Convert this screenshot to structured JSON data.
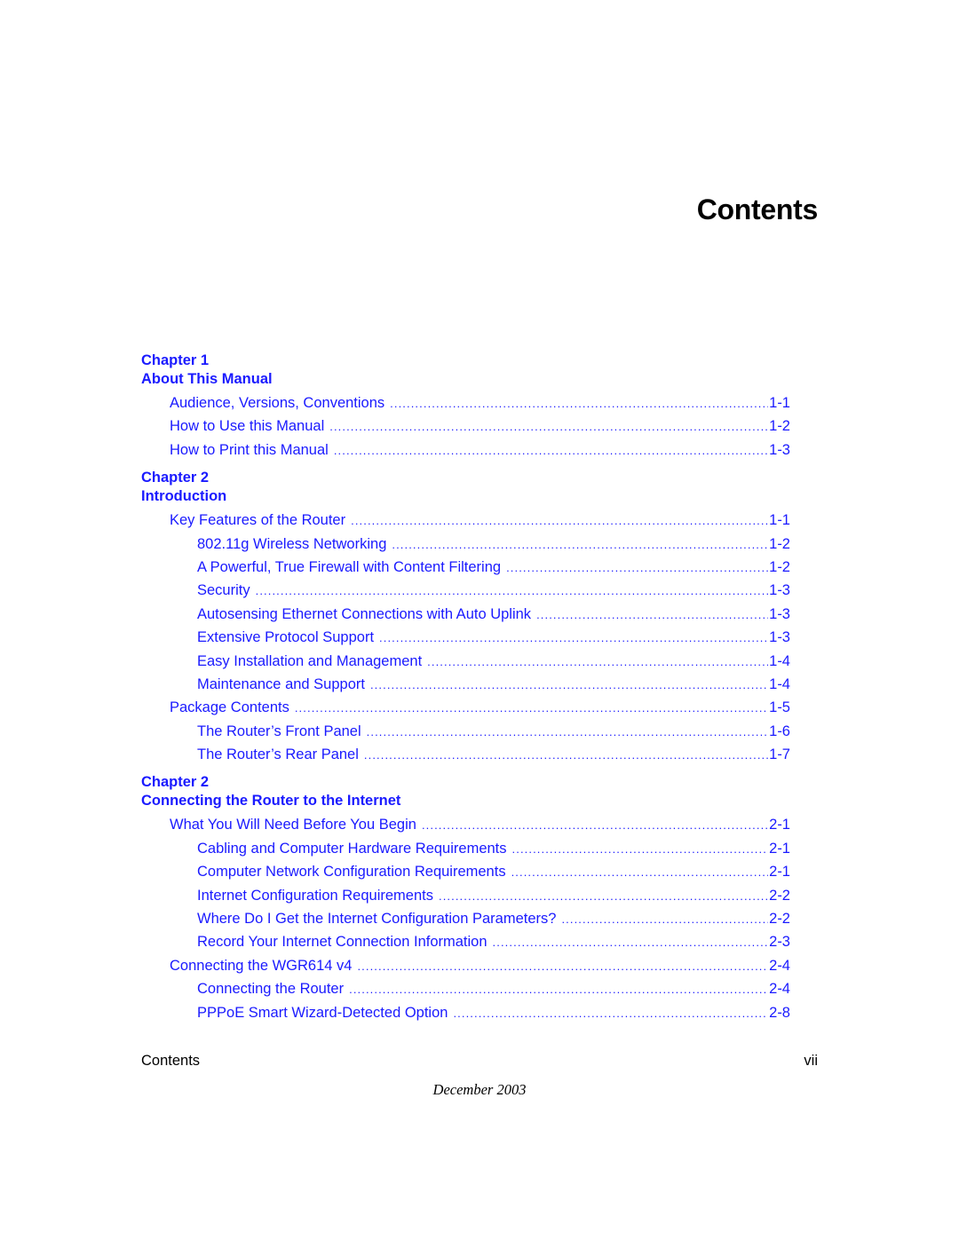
{
  "page": {
    "title": "Contents",
    "link_color": "#1a1aff"
  },
  "toc": [
    {
      "chapter": "Chapter 1",
      "title": "About This Manual",
      "entries": [
        {
          "level": 1,
          "label": "Audience, Versions, Conventions",
          "page": "1-1"
        },
        {
          "level": 1,
          "label": "How to Use this Manual",
          "page": "1-2"
        },
        {
          "level": 1,
          "label": "How to Print this Manual",
          "page": "1-3"
        }
      ]
    },
    {
      "chapter": "Chapter 2",
      "title": "Introduction",
      "entries": [
        {
          "level": 1,
          "label": "Key Features of the Router",
          "page": "1-1"
        },
        {
          "level": 2,
          "label": "802.11g Wireless Networking",
          "page": "1-2"
        },
        {
          "level": 2,
          "label": "A Powerful, True Firewall with Content Filtering",
          "page": "1-2"
        },
        {
          "level": 2,
          "label": "Security",
          "page": "1-3"
        },
        {
          "level": 2,
          "label": "Autosensing Ethernet Connections with Auto Uplink",
          "page": "1-3"
        },
        {
          "level": 2,
          "label": "Extensive Protocol Support",
          "page": "1-3"
        },
        {
          "level": 2,
          "label": "Easy Installation and Management",
          "page": "1-4"
        },
        {
          "level": 2,
          "label": "Maintenance and Support",
          "page": "1-4"
        },
        {
          "level": 1,
          "label": "Package Contents",
          "page": "1-5"
        },
        {
          "level": 2,
          "label": "The Router’s Front Panel",
          "page": "1-6"
        },
        {
          "level": 2,
          "label": "The Router’s Rear Panel",
          "page": "1-7"
        }
      ]
    },
    {
      "chapter": "Chapter 2",
      "title": "Connecting the Router to the Internet",
      "entries": [
        {
          "level": 1,
          "label": "What You Will Need Before You Begin",
          "page": "2-1"
        },
        {
          "level": 2,
          "label": "Cabling and Computer Hardware Requirements",
          "page": "2-1"
        },
        {
          "level": 2,
          "label": "Computer Network Configuration Requirements",
          "page": "2-1"
        },
        {
          "level": 2,
          "label": "Internet Configuration Requirements",
          "page": "2-2"
        },
        {
          "level": 2,
          "label": "Where Do I Get the Internet Configuration Parameters?",
          "page": "2-2"
        },
        {
          "level": 2,
          "label": "Record Your Internet Connection Information",
          "page": "2-3"
        },
        {
          "level": 1,
          "label": "Connecting the WGR614 v4",
          "page": "2-4"
        },
        {
          "level": 2,
          "label": "Connecting the Router",
          "page": "2-4"
        },
        {
          "level": 2,
          "label": "PPPoE Smart Wizard-Detected Option",
          "page": "2-8"
        }
      ]
    }
  ],
  "footer": {
    "section": "Contents",
    "page_number": "vii",
    "date": "December 2003"
  }
}
